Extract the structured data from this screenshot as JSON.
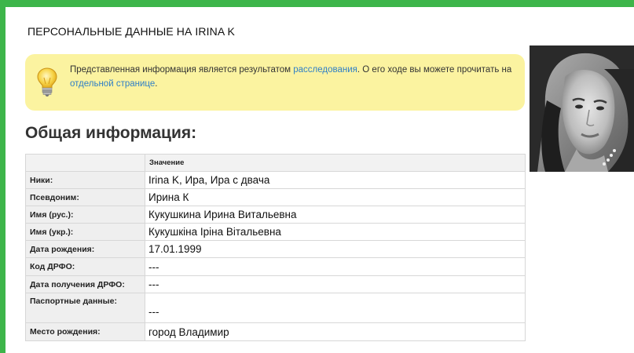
{
  "page": {
    "title": "ПЕРСОНАЛЬНЫЕ ДАННЫЕ НА IRINA K"
  },
  "notice": {
    "text_before": "Представленная информация является результатом ",
    "link1": "расследования",
    "text_middle": ". О его ходе вы можете прочитать на ",
    "link2": "отдельной странице",
    "text_after": "."
  },
  "section": {
    "title": "Общая информация:"
  },
  "table": {
    "header_key": "",
    "header_value": "Значение",
    "rows": [
      {
        "key": "Ники:",
        "value": "Irina K, Ира, Ира с двача"
      },
      {
        "key": "Псевдоним:",
        "value": "Ирина К"
      },
      {
        "key": "Имя (рус.):",
        "value": "Кукушкина Ирина Витальевна"
      },
      {
        "key": "Имя (укр.):",
        "value": "Кукушкіна Іріна Вітальевна"
      },
      {
        "key": "Дата рождения:",
        "value": "17.01.1999"
      },
      {
        "key": "Код ДРФО:",
        "value": "---"
      },
      {
        "key": "Дата получения ДРФО:",
        "value": "---"
      },
      {
        "key": "Паспортные данные:",
        "value": "---"
      },
      {
        "key": "Место рождения:",
        "value": "город Владимир"
      }
    ]
  },
  "colors": {
    "frame": "#3db54a",
    "notice_bg": "#fbf3a0",
    "link": "#2f7fc6"
  }
}
